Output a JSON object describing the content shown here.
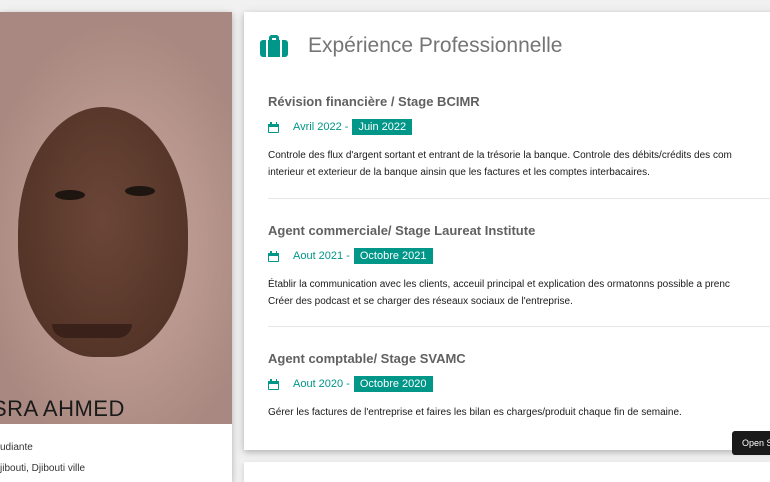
{
  "profile": {
    "name": "SRA AHMED",
    "info": [
      "udiante",
      "jibouti, Djibouti ville"
    ]
  },
  "experience": {
    "title": "Expérience Professionnelle",
    "jobs": [
      {
        "title": "Révision financière / Stage BCIMR",
        "start": "Avril 2022 -",
        "end": "Juin 2022",
        "desc": [
          "Controle des flux d'argent sortant et entrant de la trésorie la banque. Controle des débits/crédits des com",
          "interieur et exterieur de la banque ainsin que les factures et les comptes interbacaires."
        ]
      },
      {
        "title": "Agent commerciale/ Stage Laureat Institute",
        "start": "Aout 2021 -",
        "end": "Octobre 2021",
        "desc": [
          "Établir la communication avec les clients, acceuil principal et explication des ormatonns possible a prenc",
          "Créer des podcast et se charger des réseaux sociaux de l'entreprise."
        ]
      },
      {
        "title": "Agent comptable/ Stage SVAMC",
        "start": "Aout 2020 -",
        "end": "Octobre 2020",
        "desc": [
          "Gérer les factures de l'entreprise et faires les bilan es charges/produit chaque fin de semaine."
        ]
      }
    ]
  },
  "open_button": "Open S",
  "colors": {
    "accent": "#009688",
    "title_gray": "#757575"
  },
  "icons": {
    "header": "briefcase-icon",
    "date": "calendar-icon"
  }
}
